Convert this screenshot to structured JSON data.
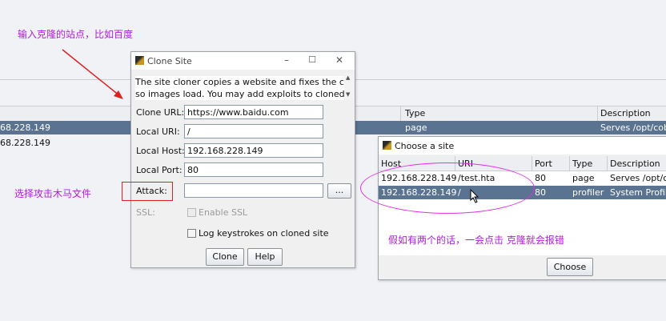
{
  "annotations": {
    "top": "输入克隆的站点，比如百度",
    "left": "选择攻击木马文件",
    "bottom_right": "假如有两个的话，一会点击  克隆就会报错"
  },
  "background_table": {
    "columns": [
      "Type",
      "Description"
    ],
    "rows": [
      {
        "host": "68.228.149",
        "type": "page",
        "description": "Serves /opt/coba"
      },
      {
        "host": "68.228.149",
        "type": "",
        "description": ""
      }
    ]
  },
  "clone_site": {
    "title": "Clone Site",
    "description_lines": [
      "The site cloner copies a website and fixes the code",
      "so images load. You may add exploits to cloned sites"
    ],
    "fields": {
      "clone_url": {
        "label": "Clone URL:",
        "value": "https://www.baidu.com"
      },
      "local_uri": {
        "label": "Local URI:",
        "value": "/"
      },
      "local_host": {
        "label": "Local Host:",
        "value": "192.168.228.149"
      },
      "local_port": {
        "label": "Local Port:",
        "value": "80"
      },
      "attack": {
        "label": "Attack:",
        "value": ""
      }
    },
    "browse_label": "...",
    "ssl_label": "SSL:",
    "enable_ssl_label": "Enable SSL",
    "log_keystrokes_label": "Log keystrokes on cloned site",
    "clone_button": "Clone",
    "help_button": "Help"
  },
  "choose_site": {
    "title": "Choose a site",
    "columns": [
      "Host",
      "URI",
      "Port",
      "Type",
      "Description"
    ],
    "rows": [
      {
        "host": "192.168.228.149",
        "uri": "/test.hta",
        "port": "80",
        "type": "page",
        "description": "Serves /opt/co"
      },
      {
        "host": "192.168.228.149",
        "uri": "/",
        "port": "80",
        "type": "profiler",
        "description": "System Profile"
      }
    ],
    "choose_button": "Choose"
  },
  "colors": {
    "annotation": "#b01edc",
    "selection": "#5a7391",
    "highlight_box": "#e02020",
    "ellipse": "#e032e6"
  }
}
